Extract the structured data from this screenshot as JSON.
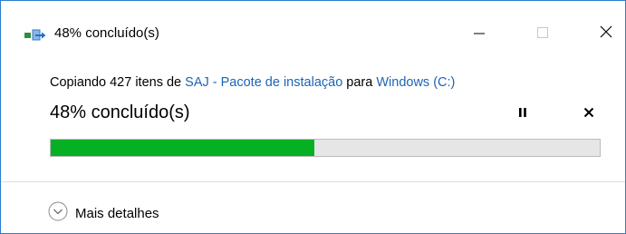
{
  "window": {
    "title": "48% concluído(s)",
    "icons": {
      "app": "file-copy-icon",
      "minimize": "minimize-icon",
      "maximize": "maximize-icon",
      "close": "close-icon"
    }
  },
  "copy": {
    "prefix": "Copiando 427 itens de ",
    "source": "SAJ - Pacote de instalação",
    "middle": " para ",
    "destination": "Windows (C:)"
  },
  "progress": {
    "label": "48% concluído(s)",
    "fraction": 0.48,
    "fill_color": "#06b025",
    "pause_icon": "pause-icon",
    "cancel_icon": "cancel-icon"
  },
  "footer": {
    "details_label": "Mais detalhes",
    "details_icon": "chevron-down-circle-icon"
  }
}
